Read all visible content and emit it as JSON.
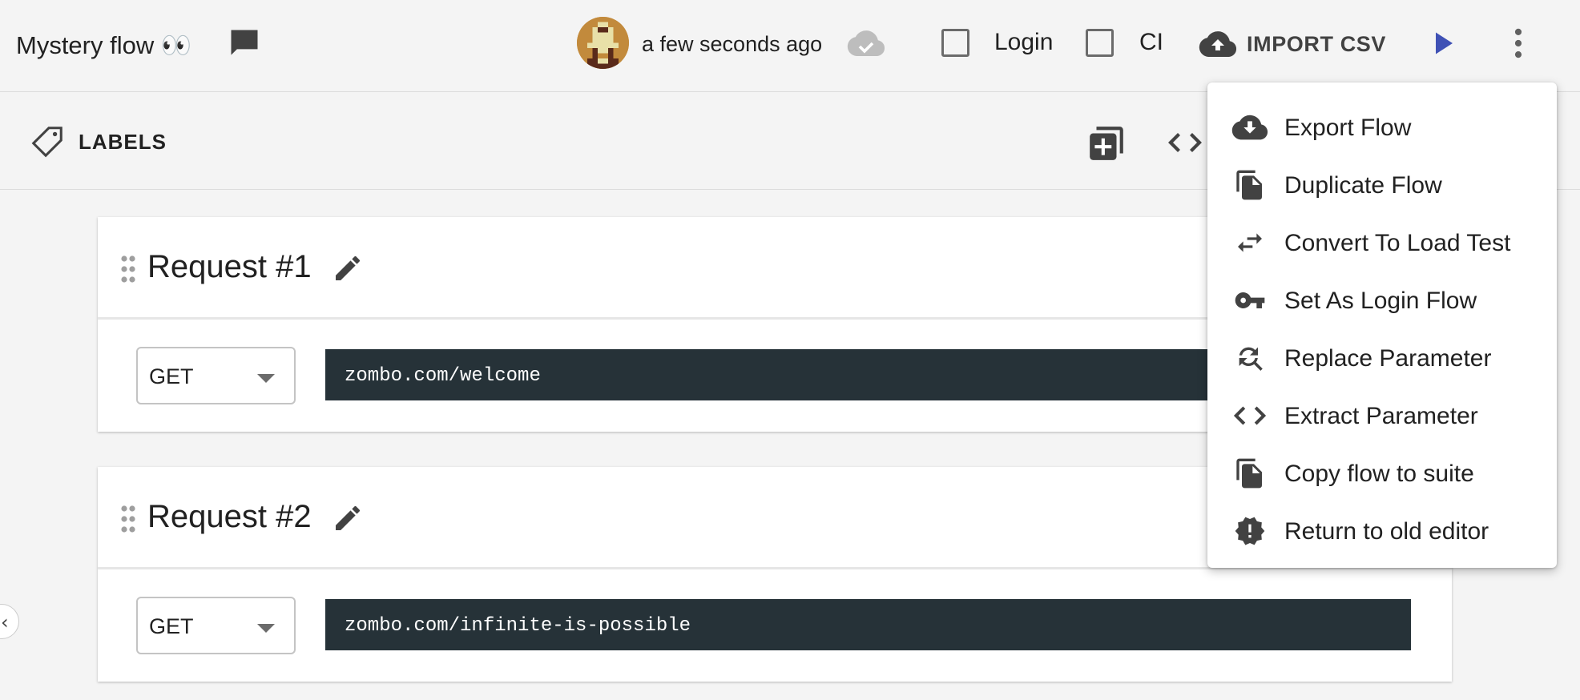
{
  "header": {
    "title": "Mystery flow 👀",
    "saved_status": "a few seconds ago",
    "login_label": "Login",
    "ci_label": "CI",
    "import_label": "IMPORT CSV"
  },
  "toolbar": {
    "labels_label": "LABELS"
  },
  "requests": [
    {
      "title": "Request #1",
      "method": "GET",
      "url": "zombo.com/welcome"
    },
    {
      "title": "Request #2",
      "method": "GET",
      "url": "zombo.com/infinite-is-possible"
    }
  ],
  "menu": {
    "items": [
      {
        "label": "Export Flow",
        "icon": "cloud-download-icon"
      },
      {
        "label": "Duplicate Flow",
        "icon": "copy-icon"
      },
      {
        "label": "Convert To Load Test",
        "icon": "swap-arrows-icon"
      },
      {
        "label": "Set As Login Flow",
        "icon": "key-icon"
      },
      {
        "label": "Replace Parameter",
        "icon": "find-replace-icon"
      },
      {
        "label": "Extract Parameter",
        "icon": "code-icon"
      },
      {
        "label": "Copy flow to suite",
        "icon": "copy-icon"
      },
      {
        "label": "Return to old editor",
        "icon": "alert-badge-icon"
      }
    ]
  },
  "colors": {
    "accent_play": "#3f51b5",
    "url_bg": "#263238",
    "icon_gray": "#424242"
  }
}
